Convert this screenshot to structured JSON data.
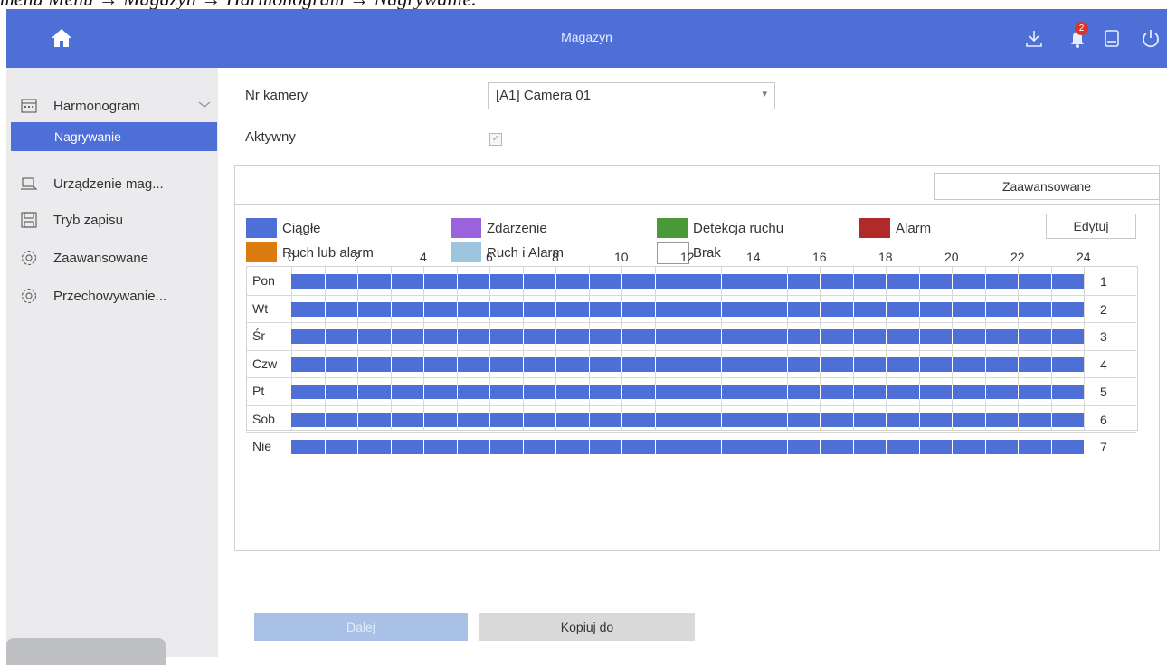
{
  "caption": "menu Menu → Magazyn → Harmonogram → Nagrywanie.",
  "topbar": {
    "title": "Magazyn",
    "notification_count": "2",
    "icons": [
      "home-icon",
      "download-icon",
      "bell-icon",
      "storage-icon",
      "power-icon"
    ]
  },
  "sidebar": {
    "schedule": "Harmonogram",
    "recording": "Nagrywanie",
    "storage_device": "Urządzenie mag...",
    "record_mode": "Tryb zapisu",
    "advanced": "Zaawansowane",
    "retention": "Przechowywanie..."
  },
  "form": {
    "camera_label": "Nr kamery",
    "camera_value": "[A1] Camera 01",
    "enabled_label": "Aktywny"
  },
  "panel": {
    "advanced_button": "Zaawansowane",
    "edit_button": "Edytuj",
    "legend": [
      {
        "label": "Ciągłe",
        "color": "#4d6fd6"
      },
      {
        "label": "Zdarzenie",
        "color": "#9a63db"
      },
      {
        "label": "Detekcja ruchu",
        "color": "#4b9a3a"
      },
      {
        "label": "Alarm",
        "color": "#b02a2a"
      },
      {
        "label": "Ruch lub alarm",
        "color": "#d97b0f"
      },
      {
        "label": "Ruch i Alarm",
        "color": "#9ec5de"
      },
      {
        "label": "Brak",
        "color": "#ffffff"
      }
    ],
    "hours": [
      "0",
      "2",
      "4",
      "6",
      "8",
      "10",
      "12",
      "14",
      "16",
      "18",
      "20",
      "22",
      "24"
    ],
    "days": [
      {
        "label": "Pon",
        "num": "1"
      },
      {
        "label": "Wt",
        "num": "2"
      },
      {
        "label": "Śr",
        "num": "3"
      },
      {
        "label": "Czw",
        "num": "4"
      },
      {
        "label": "Pt",
        "num": "5"
      },
      {
        "label": "Sob",
        "num": "6"
      },
      {
        "label": "Nie",
        "num": "7"
      }
    ]
  },
  "footer": {
    "next_button": "Dalej",
    "copy_button": "Kopiuj do"
  }
}
